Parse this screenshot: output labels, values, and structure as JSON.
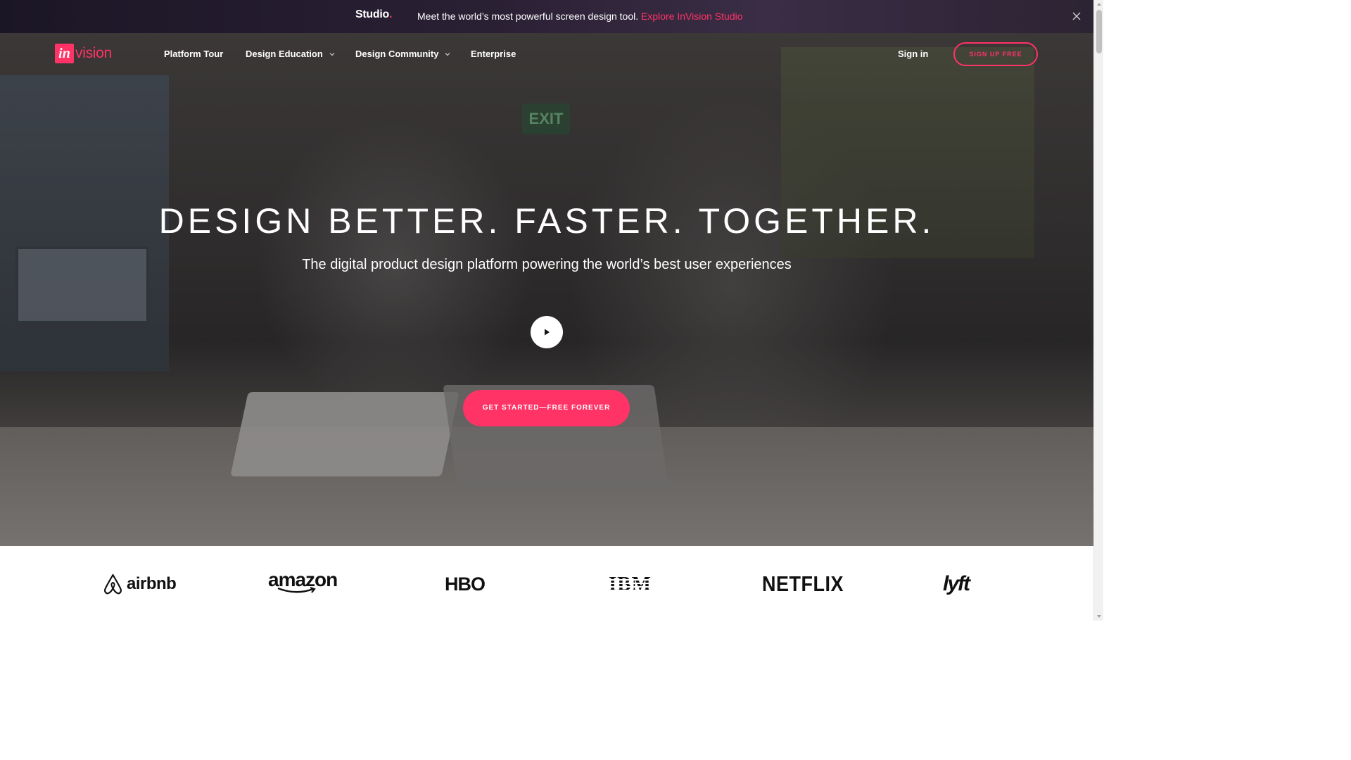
{
  "promo": {
    "studio_label": "Studio",
    "studio_dot": ".",
    "message": "Meet the world’s most powerful screen design tool.",
    "link_label": "Explore InVision Studio"
  },
  "nav": {
    "logo_in": "in",
    "logo_vision": "vision",
    "items": [
      {
        "label": "Platform Tour"
      },
      {
        "label": "Design Education"
      },
      {
        "label": "Design Community"
      },
      {
        "label": "Enterprise"
      }
    ],
    "sign_in": "Sign in",
    "sign_up": "SIGN UP FREE"
  },
  "hero": {
    "exit_sign": "EXIT",
    "headline": "DESIGN BETTER. FASTER. TOGETHER.",
    "subhead": "The digital product design platform powering the world’s best user experiences",
    "cta": "GET STARTED—FREE FOREVER",
    "play_icon": "play-icon"
  },
  "logos": {
    "airbnb": "airbnb",
    "amazon": "amazon",
    "hbo": "HBO",
    "ibm": "IBM",
    "netflix": "NETFLIX",
    "lyft": "lyft"
  },
  "colors": {
    "accent": "#ff3366",
    "promo_bg": "#2a2034",
    "text_light": "#ffffff"
  }
}
